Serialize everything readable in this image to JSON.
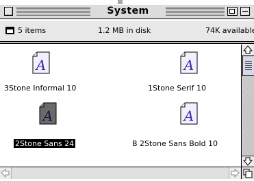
{
  "window": {
    "title": "System",
    "info": {
      "items": "5 items",
      "disk": "1.2 MB in disk",
      "available": "74K available"
    }
  },
  "files": [
    {
      "name": "3Stone Informal 10",
      "icon": "font-file-icon",
      "selected": false
    },
    {
      "name": "1Stone Serif 10",
      "icon": "font-file-icon",
      "selected": false
    },
    {
      "name": "2Stone Sans 24",
      "icon": "font-file-icon",
      "selected": true
    },
    {
      "name": "B 2Stone Sans Bold 10",
      "icon": "font-file-icon",
      "selected": false
    }
  ],
  "colors": {
    "selection": "#000000",
    "icon_glyph": "#3a2a9a",
    "window_chrome": "#dcdcdc"
  }
}
